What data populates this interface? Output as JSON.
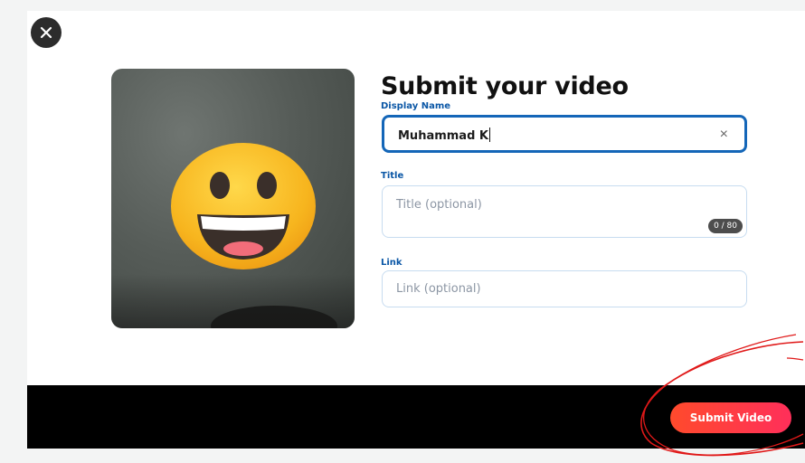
{
  "modal": {
    "heading": "Submit your video"
  },
  "close_icon": "close-icon",
  "fields": {
    "display_name": {
      "label": "Display Name",
      "value": "Muhammad K",
      "clear_glyph": "×"
    },
    "title": {
      "label": "Title",
      "placeholder": "Title (optional)",
      "counter": "0 / 80"
    },
    "link": {
      "label": "Link",
      "placeholder": "Link (optional)"
    }
  },
  "footer": {
    "submit_label": "Submit Video"
  },
  "colors": {
    "accent": "#1466b8",
    "label_blue": "#0b57a6",
    "submit_start": "#ff4a2c",
    "submit_end": "#ff2f5a",
    "annotation_red": "#e01919"
  }
}
